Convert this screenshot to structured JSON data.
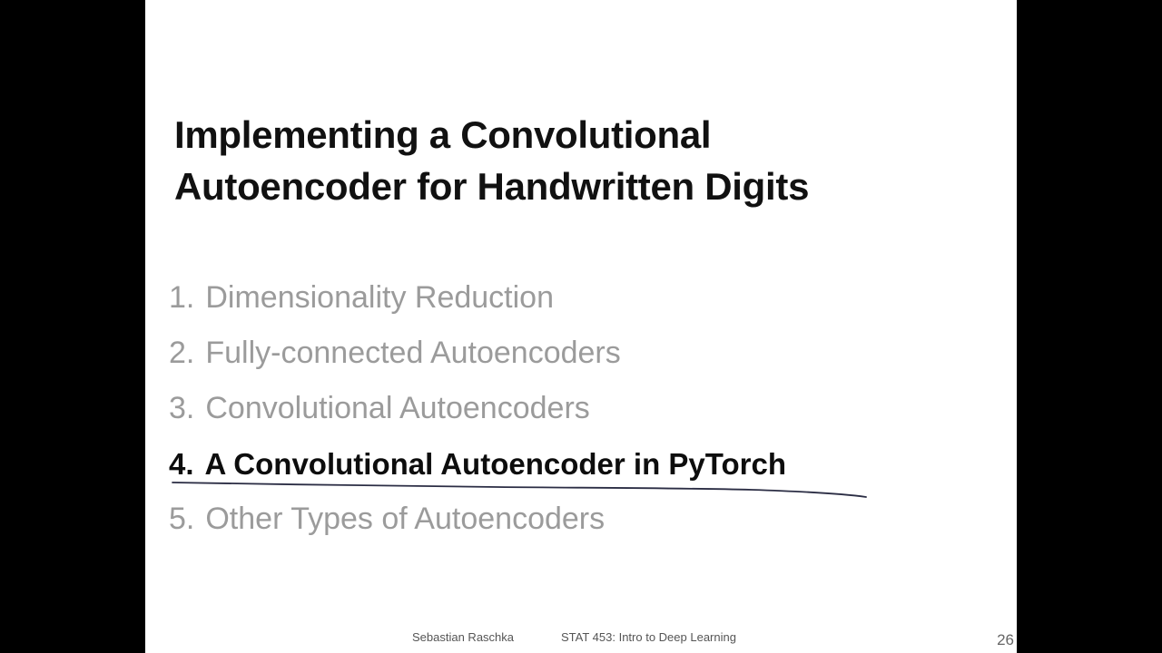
{
  "slide": {
    "title_lines": [
      "Implementing a Convolutional",
      "Autoencoder for Handwritten Digits"
    ],
    "outline": [
      {
        "number": "1.",
        "text": "Dimensionality Reduction",
        "active": false
      },
      {
        "number": "2.",
        "text": "Fully-connected Autoencoders",
        "active": false
      },
      {
        "number": "3.",
        "text": "Convolutional Autoencoders",
        "active": false
      },
      {
        "number": "4.",
        "text": "A Convolutional Autoencoder in PyTorch",
        "active": true
      },
      {
        "number": "5.",
        "text": "Other Types of Autoencoders",
        "active": false
      }
    ],
    "footer": {
      "author": "Sebastian Raschka",
      "course": "STAT 453: Intro to Deep Learning"
    },
    "page_number": "26"
  },
  "colors": {
    "background": "#000000",
    "slide": "#ffffff",
    "title": "#111111",
    "inactive_item": "#9b9b9b",
    "active_item": "#0d0d0d",
    "underline": "#2b2d44"
  }
}
